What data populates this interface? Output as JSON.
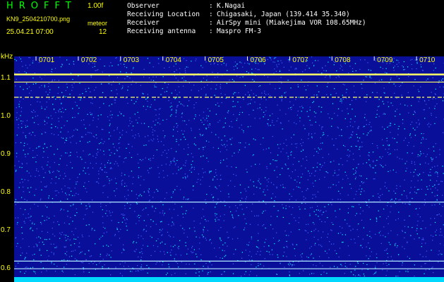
{
  "header": {
    "app_title": "HROFFT",
    "version": "1.00f",
    "filename": "KN9_2504210700.png",
    "meteor_label": "meteor",
    "datetime": "25.04.21 07:00",
    "meteor_count": "12"
  },
  "info": [
    {
      "key": "Observer",
      "sep": ":",
      "value": "K.Nagai"
    },
    {
      "key": "Receiving Location",
      "sep": ":",
      "value": "Chigasaki, Japan (139.414 35.340)"
    },
    {
      "key": "Receiver",
      "sep": ":",
      "value": "AirSpy mini (Miakejima VOR 108.65MHz)"
    },
    {
      "key": "Receiving antenna",
      "sep": ":",
      "value": "Maspro FM-3"
    }
  ],
  "chart_data": {
    "type": "heatmap",
    "ylabel": "kHz",
    "y_ticks": [
      "1.1",
      "1.0",
      "0.9",
      "0.8",
      "0.7",
      "0.6"
    ],
    "x_ticks": [
      "0701",
      "0702",
      "0703",
      "0704",
      "0705",
      "0706",
      "0707",
      "0708",
      "0709",
      "0710"
    ],
    "ylim": [
      0.58,
      1.15
    ],
    "signal_lines_khz": [
      1.11,
      1.09,
      1.05,
      0.775,
      0.62,
      0.6
    ],
    "colors": {
      "background": "#0a0f9a",
      "noise_bright": "#00ffff",
      "noise_dim": "#4060ff",
      "signal": "#ffff66",
      "label": "#ffff00"
    }
  }
}
